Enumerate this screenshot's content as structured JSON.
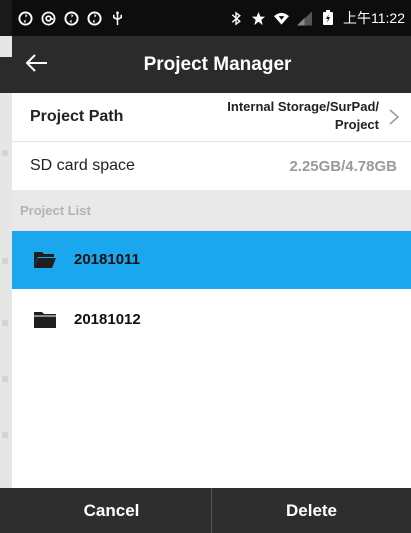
{
  "status_bar": {
    "time": "上午11:22",
    "left_icons": [
      "sync-icon",
      "at-icon",
      "sync-icon",
      "sync-icon",
      "usb-icon"
    ],
    "right_icons": [
      "bluetooth-icon",
      "star-icon",
      "wifi-icon",
      "signal-icon",
      "battery-icon"
    ]
  },
  "header": {
    "title": "Project Manager",
    "back_icon": "arrow-left-icon"
  },
  "project_path": {
    "label": "Project Path",
    "value_line1": "Internal Storage/SurPad/",
    "value_line2": "Project"
  },
  "sd_card": {
    "label": "SD card space",
    "value": "2.25GB/4.78GB"
  },
  "project_list": {
    "header": "Project List",
    "items": [
      {
        "name": "20181011",
        "selected": true
      },
      {
        "name": "20181012",
        "selected": false
      }
    ]
  },
  "footer": {
    "cancel_label": "Cancel",
    "delete_label": "Delete"
  },
  "colors": {
    "selected": "#1aa7ee",
    "header_bg": "#2b2b2b",
    "footer_bg": "#2e2e2e"
  }
}
